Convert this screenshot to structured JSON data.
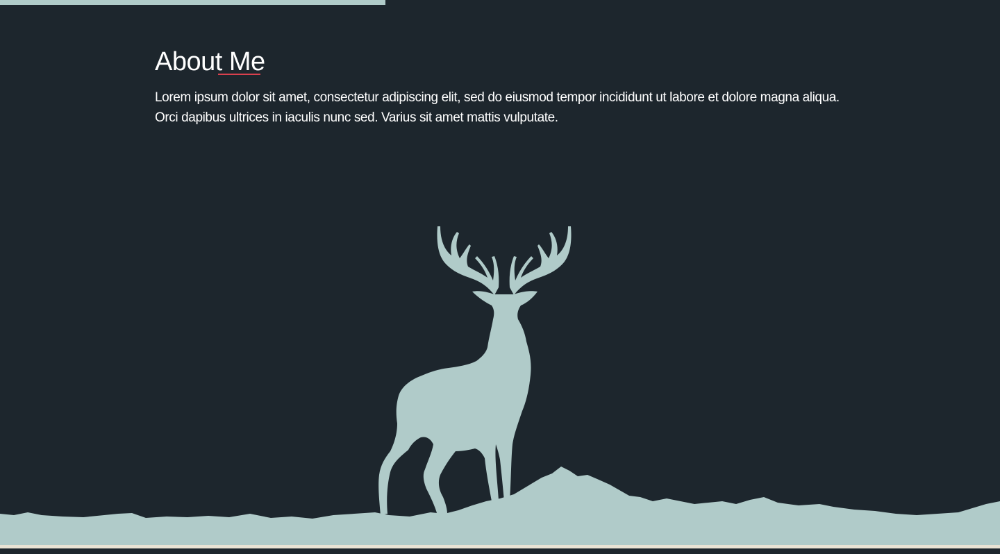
{
  "about": {
    "title": "About Me",
    "body": "Lorem ipsum dolor sit amet, consectetur adipiscing elit, sed do eiusmod tempor incididunt ut labore et dolore magna aliqua. Orci dapibus ultrices in iaculis nunc sed. Varius sit amet mattis vulputate."
  },
  "colors": {
    "background": "#1d262d",
    "accent": "#b0cbc9",
    "underline": "#d9404e",
    "text": "#ffffff"
  },
  "illustration": {
    "icon": "deer-silhouette-icon"
  }
}
